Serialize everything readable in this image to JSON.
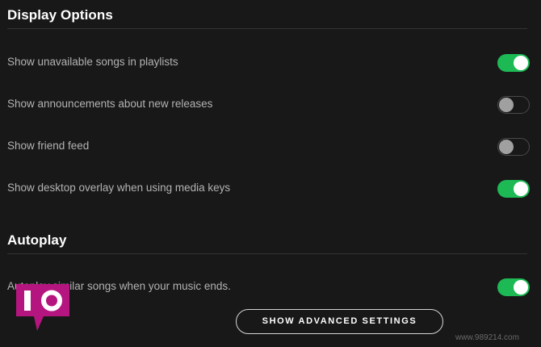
{
  "display_options": {
    "title": "Display Options",
    "settings": [
      {
        "label": "Show unavailable songs in playlists",
        "enabled": true
      },
      {
        "label": "Show announcements about new releases",
        "enabled": false
      },
      {
        "label": "Show friend feed",
        "enabled": false
      },
      {
        "label": "Show desktop overlay when using media keys",
        "enabled": true
      }
    ]
  },
  "autoplay": {
    "title": "Autoplay",
    "settings": [
      {
        "label": "Autoplay similar songs when your music ends.",
        "enabled": true
      }
    ]
  },
  "footer": {
    "advanced_button_label": "SHOW ADVANCED SETTINGS"
  },
  "overlay": {
    "logo_text": "IO",
    "logo_color": "#b5157f",
    "watermark": "www.989214.com"
  },
  "colors": {
    "background": "#181818",
    "toggle_on": "#1db954",
    "toggle_off_knob": "#a0a0a0",
    "text_primary": "#ffffff",
    "text_secondary": "#b3b3b3"
  }
}
